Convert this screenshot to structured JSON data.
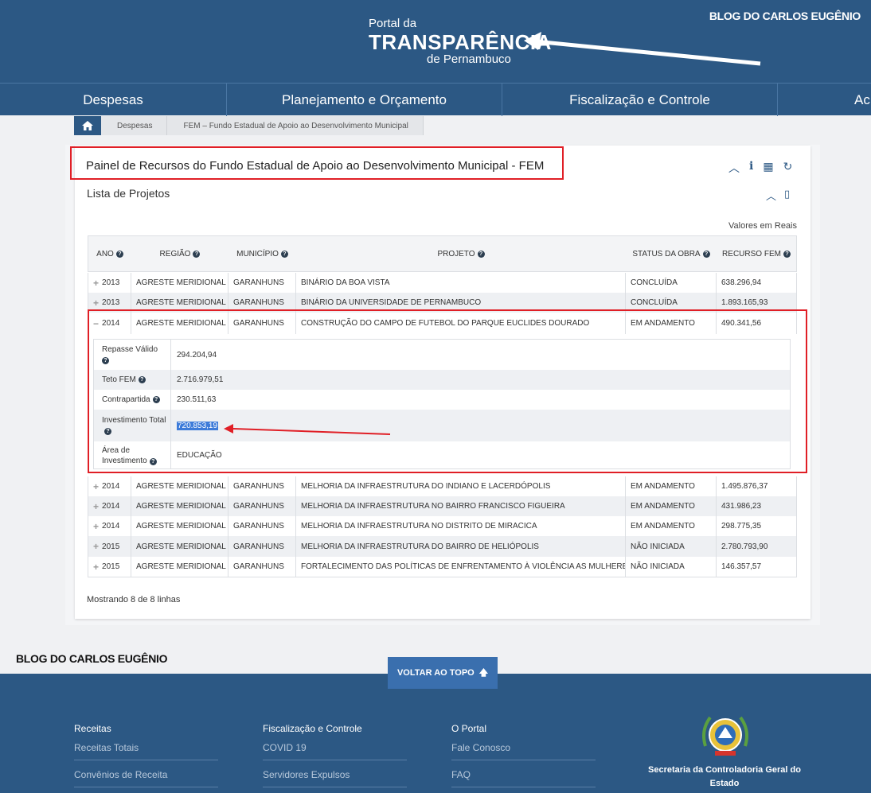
{
  "header": {
    "logo_line1": "Portal da",
    "logo_line2": "TRANSPARÊNCIA",
    "logo_line3": "de Pernambuco",
    "watermark": "BLOG DO CARLOS EUGÊNIO"
  },
  "nav": {
    "items": [
      "Despesas",
      "Planejamento e Orçamento",
      "Fiscalização e Controle",
      "Ac"
    ]
  },
  "breadcrumb": {
    "home_icon": "home-icon",
    "items": [
      "Despesas",
      "FEM – Fundo Estadual de Apoio ao Desenvolvimento Municipal"
    ]
  },
  "panel": {
    "title": "Painel de Recursos do Fundo Estadual de Apoio ao Desenvolvimento Municipal - FEM",
    "tools": [
      "chevron-up-icon",
      "info-icon",
      "table-icon",
      "refresh-icon"
    ],
    "tool_glyphs": [
      "︿",
      "i",
      "▦",
      "↻"
    ]
  },
  "list": {
    "title": "Lista de Projetos",
    "tool_glyphs": [
      "︿",
      "▯"
    ],
    "units_note": "Valores em Reais",
    "columns": [
      "ANO",
      "REGIÃO",
      "MUNICÍPIO",
      "PROJETO",
      "STATUS DA OBRA",
      "RECURSO FEM"
    ],
    "rows": [
      {
        "toggle": "+",
        "ano": "2013",
        "regiao": "AGRESTE MERIDIONAL",
        "municipio": "GARANHUNS",
        "projeto": "BINÁRIO DA BOA VISTA",
        "status": "CONCLUÍDA",
        "recurso": "638.296,94"
      },
      {
        "toggle": "+",
        "ano": "2013",
        "regiao": "AGRESTE MERIDIONAL",
        "municipio": "GARANHUNS",
        "projeto": "BINÁRIO DA UNIVERSIDADE DE PERNAMBUCO",
        "status": "CONCLUÍDA",
        "recurso": "1.893.165,93"
      },
      {
        "toggle": "−",
        "ano": "2014",
        "regiao": "AGRESTE MERIDIONAL",
        "municipio": "GARANHUNS",
        "projeto": "CONSTRUÇÃO DO CAMPO DE FUTEBOL DO PARQUE EUCLIDES DOURADO",
        "status": "EM ANDAMENTO",
        "recurso": "490.341,56"
      },
      {
        "toggle": "+",
        "ano": "2014",
        "regiao": "AGRESTE MERIDIONAL",
        "municipio": "GARANHUNS",
        "projeto": "MELHORIA DA INFRAESTRUTURA DO INDIANO E LACERDÓPOLIS",
        "status": "EM ANDAMENTO",
        "recurso": "1.495.876,37"
      },
      {
        "toggle": "+",
        "ano": "2014",
        "regiao": "AGRESTE MERIDIONAL",
        "municipio": "GARANHUNS",
        "projeto": "MELHORIA DA INFRAESTRUTURA NO BAIRRO FRANCISCO FIGUEIRA",
        "status": "EM ANDAMENTO",
        "recurso": "431.986,23"
      },
      {
        "toggle": "+",
        "ano": "2014",
        "regiao": "AGRESTE MERIDIONAL",
        "municipio": "GARANHUNS",
        "projeto": "MELHORIA DA INFRAESTRUTURA NO DISTRITO DE MIRACICA",
        "status": "EM ANDAMENTO",
        "recurso": "298.775,35"
      },
      {
        "toggle": "+",
        "ano": "2015",
        "regiao": "AGRESTE MERIDIONAL",
        "municipio": "GARANHUNS",
        "projeto": "MELHORIA DA INFRAESTRUTURA DO BAIRRO DE HELIÓPOLIS",
        "status": "NÃO INICIADA",
        "recurso": "2.780.793,90"
      },
      {
        "toggle": "+",
        "ano": "2015",
        "regiao": "AGRESTE MERIDIONAL",
        "municipio": "GARANHUNS",
        "projeto": "FORTALECIMENTO DAS POLÍTICAS DE ENFRENTAMENTO À VIOLÊNCIA AS MULHERES",
        "status": "NÃO INICIADA",
        "recurso": "146.357,57"
      }
    ],
    "detail": [
      {
        "label": "Repasse Válido",
        "value": "294.204,94"
      },
      {
        "label": "Teto FEM",
        "value": "2.716.979,51"
      },
      {
        "label": "Contrapartida",
        "value": "230.511,63"
      },
      {
        "label": "Investimento Total",
        "value": "720.853,19"
      },
      {
        "label": "Área de Investimento",
        "value": "EDUCAÇÃO"
      }
    ],
    "footer_count": "Mostrando 8 de 8 linhas"
  },
  "back_to_top": {
    "label": "VOLTAR AO TOPO",
    "icon": "arrow-up-icon"
  },
  "watermark_bottom": "BLOG DO CARLOS EUGÊNIO",
  "footer": {
    "columns": [
      {
        "title": "Receitas",
        "links": [
          "Receitas Totais",
          "Convênios de Receita"
        ]
      },
      {
        "title": "Fiscalização e Controle",
        "links": [
          "COVID 19",
          "Servidores Expulsos"
        ]
      },
      {
        "title": "O Portal",
        "links": [
          "Fale Conosco",
          "FAQ"
        ]
      }
    ],
    "agency": "Secretaria da Controladoria Geral do Estado"
  },
  "colors": {
    "brand": "#2c5884",
    "highlight_box": "#e01f26",
    "selection": "#3d7bd9"
  }
}
